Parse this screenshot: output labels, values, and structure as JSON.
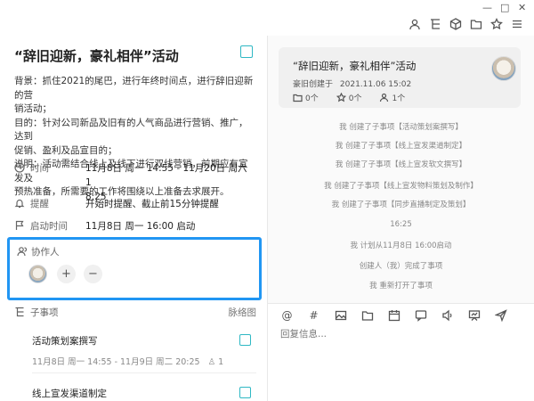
{
  "window": {
    "minimize": "—",
    "maximize": "□",
    "close": "✕"
  },
  "toolbar": [
    "person-icon",
    "branch-icon",
    "cube-icon",
    "folder-icon",
    "star-icon",
    "menu-icon"
  ],
  "task": {
    "title": "“辞旧迎新，豪礼相伴”活动",
    "description": [
      "背景：抓住2021的尾巴，进行年终时间点，进行辞旧迎新的营",
      "销活动；",
      "目的：针对公司新品及旧有的人气商品进行营销、推广，达到",
      "促销、盈利及品宣目的；",
      "说明：活动需结合线上及线下进行双线营销，前期应有宣发及",
      "预热准备，所需要的工作将围绕以上准备去求展开。"
    ],
    "time": {
      "label": "时间",
      "value_line1": "11月8日 周一 14:55 - 11月20日 周六 1",
      "value_line2": "8:25"
    },
    "reminder": {
      "label": "提醒",
      "value": "开始时提醒、截止前15分钟提醒"
    },
    "start": {
      "label": "启动时间",
      "value": "11月8日 周一 16:00 启动"
    },
    "collaborators": {
      "label": "协作人",
      "add": "+",
      "remove": "−"
    },
    "subtasks": {
      "label": "子事项",
      "view": "脉络图",
      "items": [
        {
          "title": "活动策划案撰写",
          "meta": "11月8日 周一 14:55 - 11月9日 周二 20:25",
          "count": "1"
        },
        {
          "title": "线上宣发渠道制定",
          "meta": "",
          "count": ""
        }
      ]
    }
  },
  "card": {
    "title": "“辞旧迎新，豪礼相伴”活动",
    "creator": "豪旧创建于",
    "date": "2021.11.06 15:02",
    "folders": "0个",
    "stars": "0个",
    "people": "1个"
  },
  "activity": [
    "我 创建了子事项【活动策划案撰写】",
    "我 创建了子事项【线上宣发渠道制定】",
    "我 创建了子事项【线上宣发软文撰写】",
    "我 创建了子事项【线上宣发物料策划及制作】",
    "我 创建了子事项【同步直播制定及策划】",
    "16:25",
    "我 计划从11月8日 16:00启动",
    "创建人（我）完成了事项",
    "我 重新打开了事项"
  ],
  "composer": {
    "placeholder": "回复信息..."
  }
}
